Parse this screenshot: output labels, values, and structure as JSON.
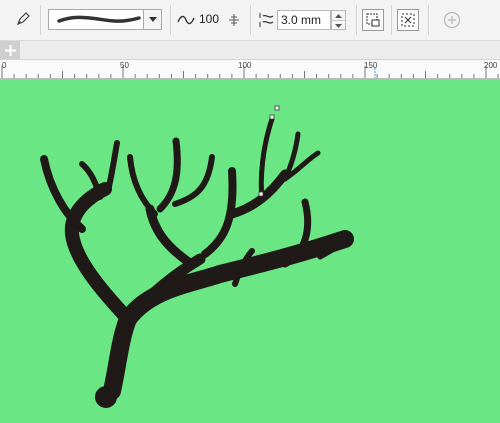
{
  "toolbar": {
    "smoothness_value": "100",
    "width_value": "3.0 mm",
    "icons": [
      "pen-tool-icon",
      "brush-stroke-preview",
      "dropdown-arrow-icon",
      "smoothing-icon",
      "smoothness-lock-icon",
      "stroke-width-icon",
      "scale-with-object-icon",
      "bounding-box-icon",
      "add-icon"
    ]
  },
  "ruler": {
    "labels": [
      "0",
      "50",
      "100",
      "150",
      "200"
    ]
  },
  "colors": {
    "canvas": "#6be685",
    "tree": "#1f1a17",
    "ruler_marker": "#2a9df4"
  }
}
